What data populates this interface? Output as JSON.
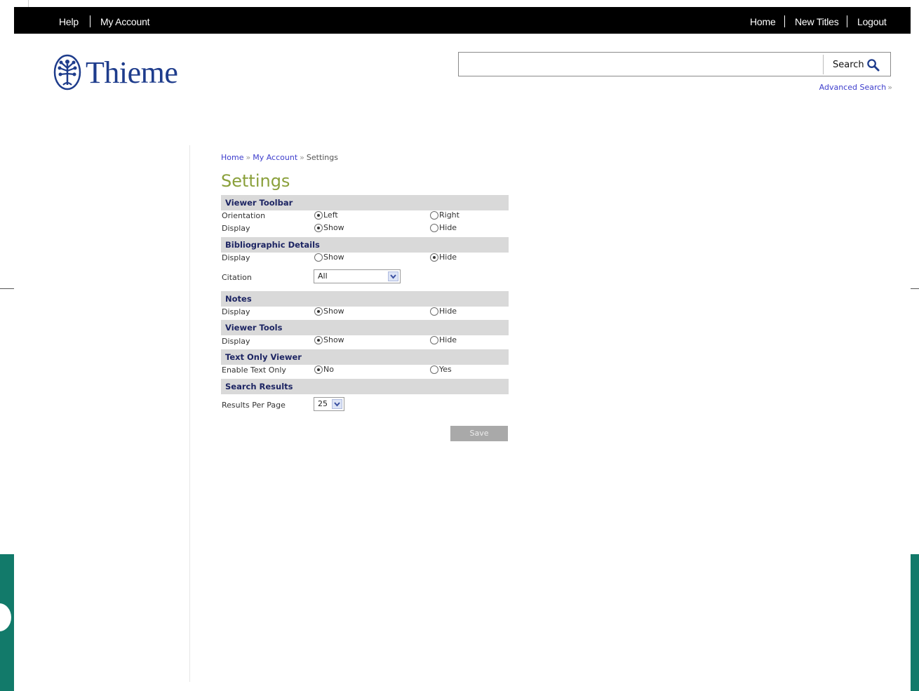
{
  "topbar": {
    "help": "Help",
    "my_account": "My Account",
    "home": "Home",
    "new_titles": "New Titles",
    "logout": "Logout"
  },
  "logo": {
    "text": "Thieme"
  },
  "search": {
    "value": "",
    "button_label": "Search",
    "advanced_label": "Advanced Search",
    "advanced_arrow": "»"
  },
  "breadcrumb": {
    "home": "Home",
    "my_account": "My Account",
    "current": "Settings",
    "separator": "»"
  },
  "page_title": "Settings",
  "sections": {
    "viewer_toolbar": {
      "title": "Viewer Toolbar",
      "orientation_label": "Orientation",
      "orientation_options": [
        "Left",
        "Right"
      ],
      "orientation_selected": "Left",
      "display_label": "Display",
      "display_options": [
        "Show",
        "Hide"
      ],
      "display_selected": "Show"
    },
    "bibliographic_details": {
      "title": "Bibliographic Details",
      "display_label": "Display",
      "display_options": [
        "Show",
        "Hide"
      ],
      "display_selected": "Hide",
      "citation_label": "Citation",
      "citation_value": "All"
    },
    "notes": {
      "title": "Notes",
      "display_label": "Display",
      "display_options": [
        "Show",
        "Hide"
      ],
      "display_selected": "Show"
    },
    "viewer_tools": {
      "title": "Viewer Tools",
      "display_label": "Display",
      "display_options": [
        "Show",
        "Hide"
      ],
      "display_selected": "Show"
    },
    "text_only_viewer": {
      "title": "Text Only Viewer",
      "enable_label": "Enable Text Only",
      "enable_options": [
        "No",
        "Yes"
      ],
      "enable_selected": "No"
    },
    "search_results": {
      "title": "Search Results",
      "per_page_label": "Results Per Page",
      "per_page_value": "25"
    }
  },
  "save_label": "Save",
  "colors": {
    "topbar_bg": "#000000",
    "logo_blue": "#1e3c8c",
    "title_green": "#8aa03b",
    "link_blue": "#3d3dcc",
    "section_bg": "#d9d9d9",
    "section_text": "#1d2563",
    "save_bg": "#a9a9a9",
    "frame_teal": "#127a6a"
  }
}
